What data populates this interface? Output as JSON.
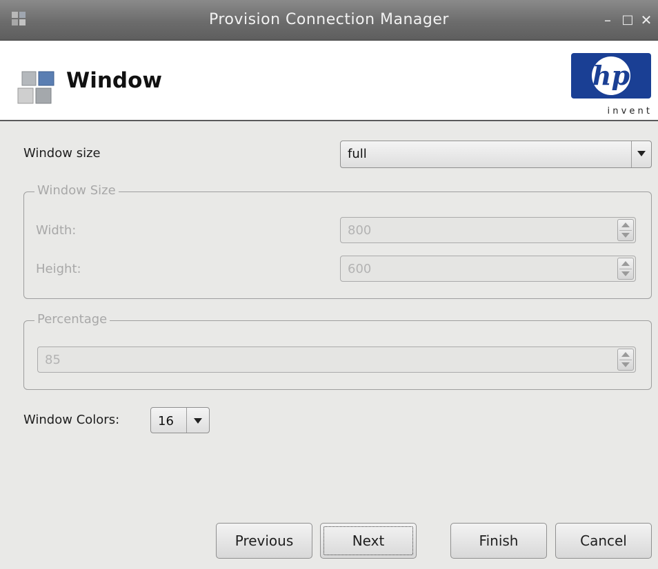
{
  "window": {
    "title": "Provision Connection Manager",
    "controls": {
      "minimize": "–",
      "maximize": "□",
      "close": "✕"
    }
  },
  "header": {
    "title": "Window",
    "logo": {
      "brand": "hp",
      "tagline": "i n v e n t",
      "color": "#1a3f94"
    }
  },
  "form": {
    "window_size": {
      "label": "Window size",
      "value": "full"
    },
    "size_group": {
      "legend": "Window Size",
      "width": {
        "label": "Width:",
        "value": "800"
      },
      "height": {
        "label": "Height:",
        "value": "600"
      }
    },
    "percentage_group": {
      "legend": "Percentage",
      "value": "85"
    },
    "window_colors": {
      "label": "Window Colors:",
      "value": "16"
    }
  },
  "buttons": {
    "previous": "Previous",
    "next": "Next",
    "finish": "Finish",
    "cancel": "Cancel"
  }
}
